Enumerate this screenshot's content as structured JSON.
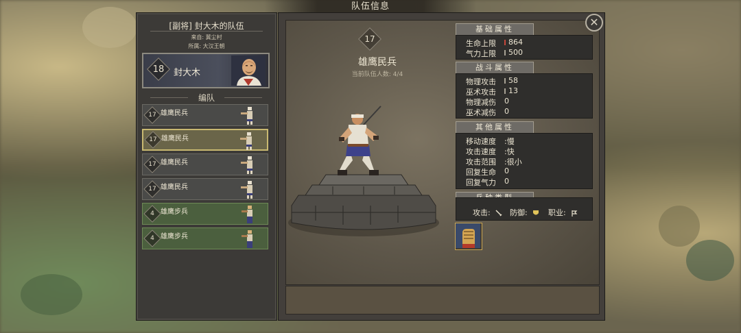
{
  "header": {
    "title": "队伍信息"
  },
  "team": {
    "title": "[副将] 封大木的队伍",
    "from": "来自: 冀尘村",
    "belong": "所属: 大汉王朝",
    "general": {
      "level": "18",
      "name": "封大木"
    },
    "formation_label": "编队",
    "units": [
      {
        "level": "17",
        "name": "雄鹰民兵",
        "style": "normal"
      },
      {
        "level": "17",
        "name": "雄鹰民兵",
        "style": "selected"
      },
      {
        "level": "17",
        "name": "雄鹰民兵",
        "style": "normal"
      },
      {
        "level": "17",
        "name": "雄鹰民兵",
        "style": "normal"
      },
      {
        "level": "4",
        "name": "雄鹰步兵",
        "style": "green"
      },
      {
        "level": "4",
        "name": "雄鹰步兵",
        "style": "green"
      }
    ]
  },
  "detail": {
    "level": "17",
    "unit_name": "雄鹰民兵",
    "count_text": "当前队伍人数: 4/4",
    "basic": {
      "title": "基础属性",
      "rows": [
        {
          "label": "生命上限",
          "value": "864"
        },
        {
          "label": "气力上限",
          "value": "500"
        }
      ]
    },
    "combat": {
      "title": "战斗属性",
      "rows": [
        {
          "label": "物理攻击",
          "value": "58"
        },
        {
          "label": "巫术攻击",
          "value": "13"
        },
        {
          "label": "物理减伤",
          "value": "0"
        },
        {
          "label": "巫术减伤",
          "value": "0"
        }
      ]
    },
    "other": {
      "title": "其他属性",
      "rows": [
        {
          "label": "移动速度",
          "value": "慢"
        },
        {
          "label": "攻击速度",
          "value": "快"
        },
        {
          "label": "攻击范围",
          "value": "很小"
        },
        {
          "label": "回复生命",
          "value": "0"
        },
        {
          "label": "回复气力",
          "value": "0"
        }
      ]
    },
    "type": {
      "title": "兵种类型",
      "attack_label": "攻击:",
      "defense_label": "防御:",
      "job_label": "职业:"
    }
  },
  "icons": {
    "close": "close-icon",
    "attack": "sword-icon",
    "defense": "shield-icon",
    "job": "banner-icon",
    "skill": "fist-skill-icon"
  },
  "colors": {
    "panel": "#3c3a37",
    "selected_border": "#c9b971",
    "green_row": "#4b5f3e",
    "hp_marker": "#c7473b"
  }
}
